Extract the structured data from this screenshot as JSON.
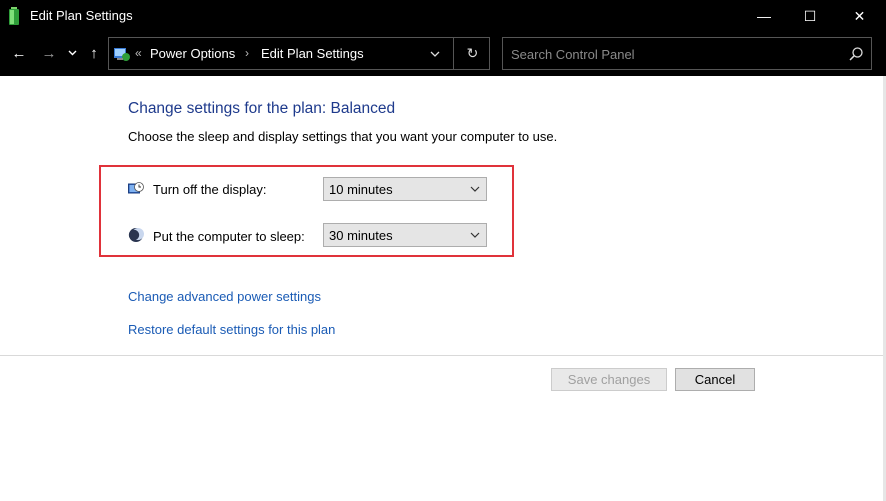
{
  "window": {
    "title": "Edit Plan Settings",
    "controls": {
      "minimize": "—",
      "maximize": "☐",
      "close": "✕"
    }
  },
  "nav": {
    "back_glyph": "←",
    "forward_glyph": "→",
    "recent_glyph": "⌄",
    "up_glyph": "↑",
    "breadcrumb": {
      "prefix": "«",
      "items": [
        "Power Options",
        "Edit Plan Settings"
      ],
      "separator": "›"
    },
    "dropdown_glyph": "⌄",
    "refresh_glyph": "↻",
    "search_placeholder": "Search Control Panel"
  },
  "main": {
    "heading": "Change settings for the plan: Balanced",
    "subtext": "Choose the sleep and display settings that you want your computer to use.",
    "settings": [
      {
        "label": "Turn off the display:",
        "value": "10 minutes",
        "icon": "display-icon"
      },
      {
        "label": "Put the computer to sleep:",
        "value": "30 minutes",
        "icon": "sleep-moon-icon"
      }
    ],
    "links": {
      "advanced": "Change advanced power settings",
      "restore": "Restore default settings for this plan"
    },
    "buttons": {
      "save": "Save changes",
      "cancel": "Cancel"
    }
  },
  "colors": {
    "heading": "#1e3a8c",
    "link": "#1a5bb5",
    "highlight_border": "#e0323a",
    "titlebar": "#000000"
  }
}
